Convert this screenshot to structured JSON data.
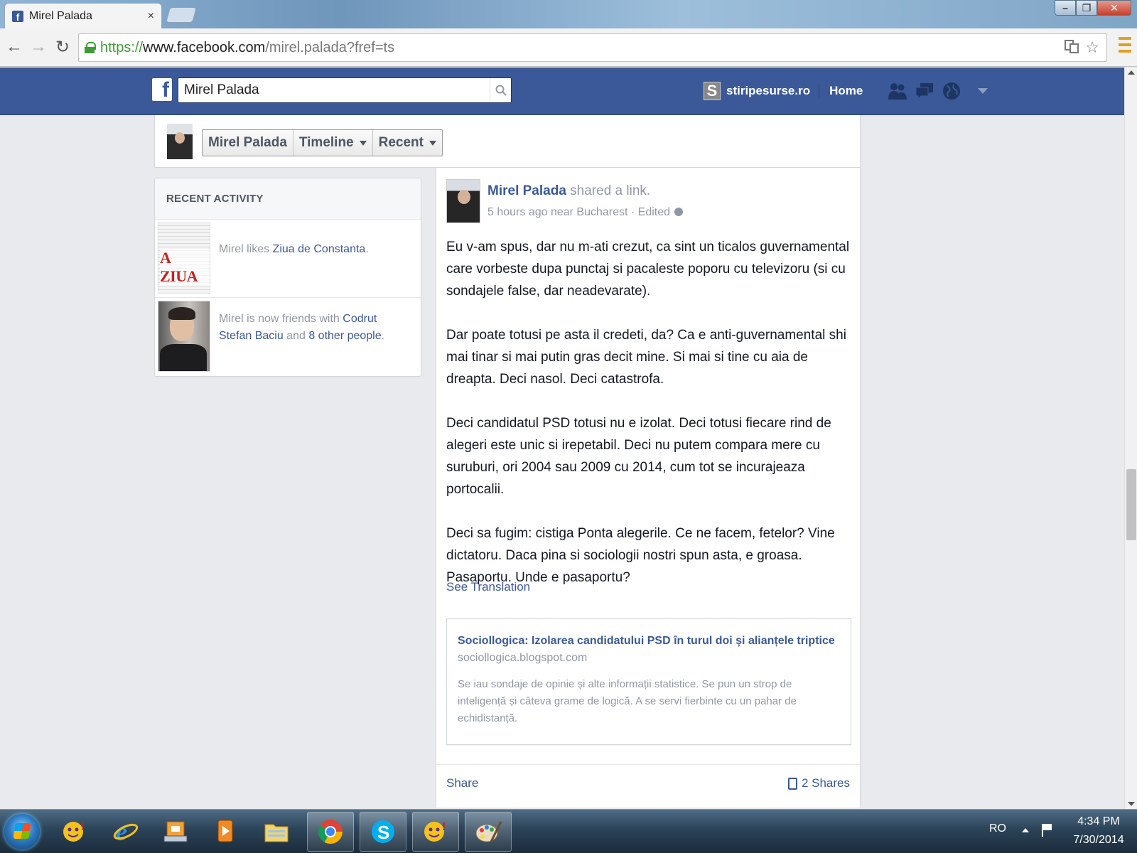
{
  "browser": {
    "tab_title": "Mirel Palada",
    "tab_close": "×",
    "url_scheme": "https://",
    "url_domain": "www.facebook.com",
    "url_path": "/mirel.palada?fref=ts",
    "window_controls": [
      "minimize",
      "maximize",
      "close"
    ]
  },
  "fb_header": {
    "logo": "f",
    "search_value": "Mirel Palada",
    "page_avatar": "S",
    "page_name": "stiripesurse.ro",
    "home_label": "Home",
    "jewels": [
      "friend-requests-icon",
      "messages-icon",
      "notifications-globe-icon"
    ]
  },
  "profile_bar": {
    "name": "Mirel Palada",
    "timeline": "Timeline",
    "recent": "Recent"
  },
  "recent_activity": {
    "heading": "RECENT ACTIVITY",
    "items": [
      {
        "thumb_logo": "ZIUA",
        "prefix": "Mirel likes ",
        "link": "Ziua de Constanta",
        "suffix": "."
      },
      {
        "prefix": "Mirel is now friends with ",
        "link": "Codrut Stefan Baciu",
        "middle": " and ",
        "link2": "8 other people",
        "suffix": "."
      }
    ]
  },
  "post": {
    "author": "Mirel Palada",
    "action": " shared a link.",
    "meta": "5 hours ago near Bucharest · Edited",
    "paragraphs": [
      "Eu v-am spus, dar nu m-ati crezut, ca sint un ticalos guvernamental care vorbeste dupa punctaj si pacaleste poporu cu televizoru (si cu sondajele false, dar neadevarate).",
      "Dar poate totusi pe asta il credeti, da? Ca e anti-guvernamental shi mai tinar si mai putin gras decit mine. Si mai si tine cu aia de dreapta. Deci nasol. Deci catastrofa.",
      "Deci candidatul PSD totusi nu e izolat. Deci totusi fiecare rind de alegeri este unic si irepetabil. Deci nu putem compara mere cu suruburi, ori 2004 sau 2009 cu 2014, cum tot se incurajeaza portocalii.",
      "Deci sa fugim: cistiga Ponta alegerile. Ce ne facem, fetelor? Vine dictatoru. Daca pina si sociologii nostri spun asta, e groasa. Pasaportu. Unde e pasaportu?"
    ],
    "see_translation": "See Translation",
    "link_card": {
      "title": "Sociollogica: Izolarea candidatului PSD în turul doi și alianțele triptice",
      "domain": "sociollogica.blogspot.com",
      "description": "Se iau sondaje de opinie și alte informații statistice. Se pun un strop de inteligență și câteva grame de logică. A se servi fierbinte cu un pahar de echidistanță."
    },
    "share_label": "Share",
    "shares_count": "2 Shares"
  },
  "taskbar": {
    "items": [
      "yahoo-messenger-icon",
      "internet-explorer-icon",
      "network-app-icon",
      "media-player-icon",
      "file-explorer-icon",
      "chrome-icon",
      "skype-icon",
      "yahoo-messenger-icon",
      "paint-icon"
    ],
    "open_items": [
      "chrome-icon",
      "skype-icon",
      "yahoo-messenger-icon",
      "paint-icon"
    ],
    "language": "RO",
    "time": "4:34 PM",
    "date": "7/30/2014"
  },
  "colors": {
    "facebook_blue": "#3b5998",
    "link_blue": "#3b5998",
    "muted_text": "#9197a3",
    "page_bg": "#e9eaed",
    "secure_green": "#3f9c35"
  }
}
